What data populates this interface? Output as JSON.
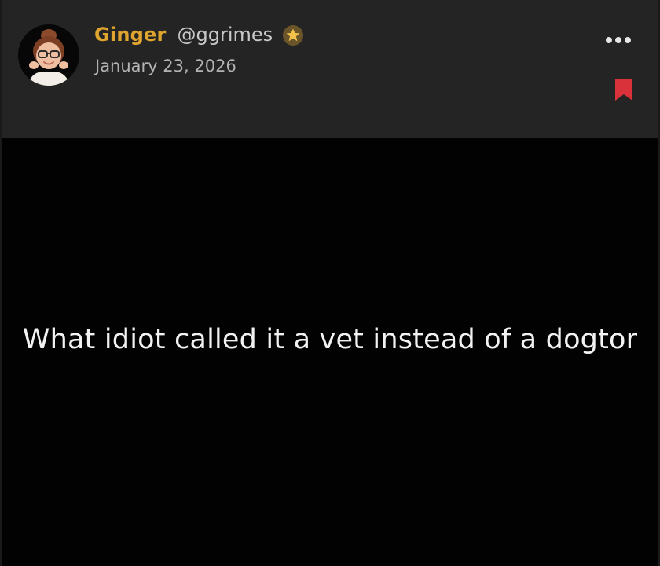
{
  "post": {
    "author": {
      "name": "Ginger",
      "handle": "@ggrimes",
      "badge_icon": "star-badge-icon",
      "avatar_icon": "memoji-avatar"
    },
    "date": "January 23, 2026",
    "actions": {
      "more_icon": "more-horizontal-icon",
      "bookmark_icon": "bookmark-icon",
      "bookmark_color": "#d9323b"
    },
    "media": {
      "caption": "What idiot called it a vet instead of a dogtor"
    }
  },
  "colors": {
    "name_accent": "#e0a52e",
    "card_background": "#242424",
    "media_background": "#020202"
  }
}
